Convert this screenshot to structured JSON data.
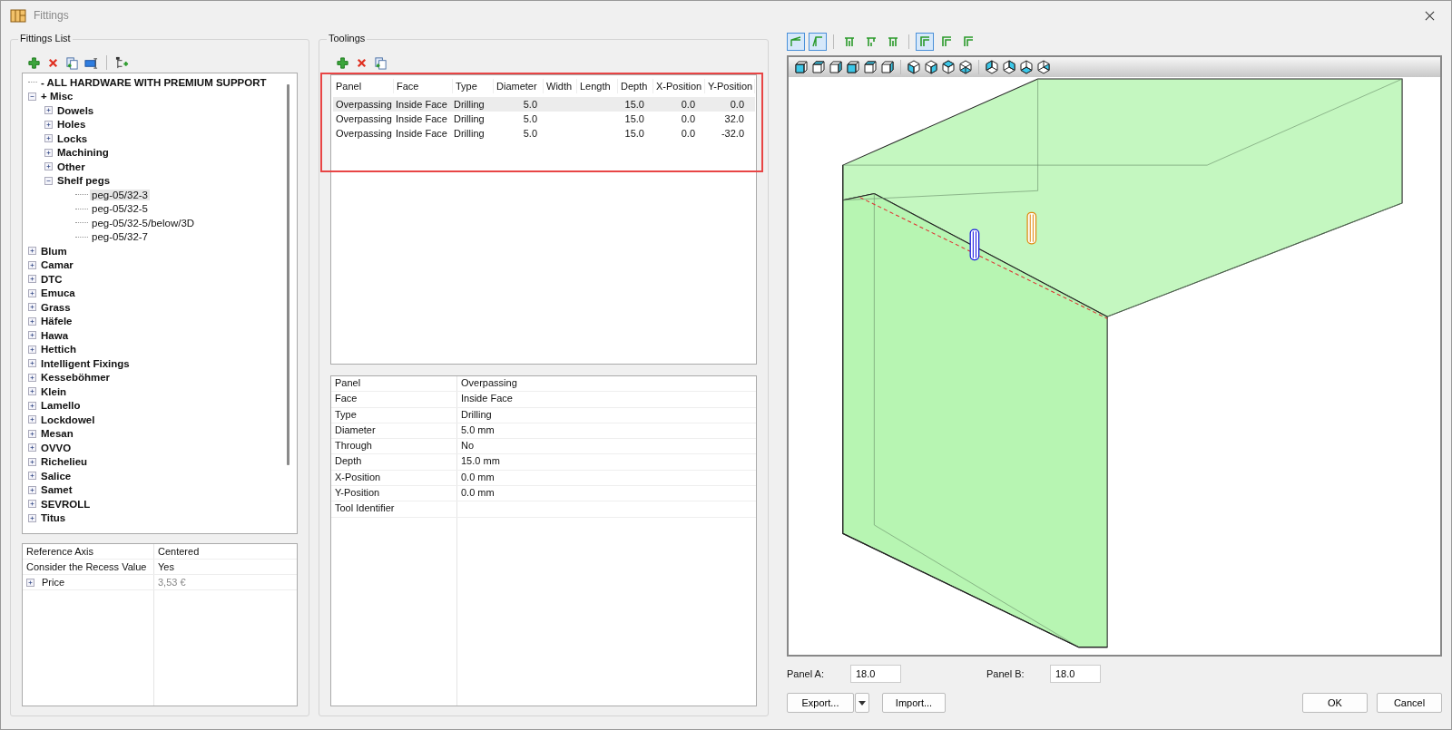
{
  "window": {
    "title": "Fittings"
  },
  "fittings_list": {
    "title": "Fittings List",
    "tree": [
      {
        "kind": "header",
        "label": "- ALL HARDWARE WITH PREMIUM SUPPORT",
        "selected": false
      },
      {
        "kind": "folder",
        "label": "+ Misc",
        "expanded": true,
        "selected": false,
        "children": [
          {
            "kind": "folder",
            "label": "Dowels",
            "expanded": false,
            "selected": false
          },
          {
            "kind": "folder",
            "label": "Holes",
            "expanded": false,
            "selected": false
          },
          {
            "kind": "folder",
            "label": "Locks",
            "expanded": false,
            "selected": false
          },
          {
            "kind": "folder",
            "label": "Machining",
            "expanded": false,
            "selected": false
          },
          {
            "kind": "folder",
            "label": "Other",
            "expanded": false,
            "selected": false
          },
          {
            "kind": "folder",
            "label": "Shelf pegs",
            "expanded": true,
            "selected": false,
            "children": [
              {
                "kind": "item",
                "label": "peg-05/32-3",
                "selected": true
              },
              {
                "kind": "item",
                "label": "peg-05/32-5",
                "selected": false
              },
              {
                "kind": "item",
                "label": "peg-05/32-5/below/3D",
                "selected": false
              },
              {
                "kind": "item",
                "label": "peg-05/32-7",
                "selected": false
              }
            ]
          }
        ]
      },
      {
        "kind": "folder",
        "label": "Blum",
        "expanded": false,
        "selected": false
      },
      {
        "kind": "folder",
        "label": "Camar",
        "expanded": false,
        "selected": false
      },
      {
        "kind": "folder",
        "label": "DTC",
        "expanded": false,
        "selected": false
      },
      {
        "kind": "folder",
        "label": "Emuca",
        "expanded": false,
        "selected": false
      },
      {
        "kind": "folder",
        "label": "Grass",
        "expanded": false,
        "selected": false
      },
      {
        "kind": "folder",
        "label": "Häfele",
        "expanded": false,
        "selected": false
      },
      {
        "kind": "folder",
        "label": "Hawa",
        "expanded": false,
        "selected": false
      },
      {
        "kind": "folder",
        "label": "Hettich",
        "expanded": false,
        "selected": false
      },
      {
        "kind": "folder",
        "label": "Intelligent Fixings",
        "expanded": false,
        "selected": false
      },
      {
        "kind": "folder",
        "label": "Kesseböhmer",
        "expanded": false,
        "selected": false
      },
      {
        "kind": "folder",
        "label": "Klein",
        "expanded": false,
        "selected": false
      },
      {
        "kind": "folder",
        "label": "Lamello",
        "expanded": false,
        "selected": false
      },
      {
        "kind": "folder",
        "label": "Lockdowel",
        "expanded": false,
        "selected": false
      },
      {
        "kind": "folder",
        "label": "Mesan",
        "expanded": false,
        "selected": false
      },
      {
        "kind": "folder",
        "label": "OVVO",
        "expanded": false,
        "selected": false
      },
      {
        "kind": "folder",
        "label": "Richelieu",
        "expanded": false,
        "selected": false
      },
      {
        "kind": "folder",
        "label": "Salice",
        "expanded": false,
        "selected": false
      },
      {
        "kind": "folder",
        "label": "Samet",
        "expanded": false,
        "selected": false
      },
      {
        "kind": "folder",
        "label": "SEVROLL",
        "expanded": false,
        "selected": false
      },
      {
        "kind": "folder",
        "label": "Titus",
        "expanded": false,
        "selected": false
      }
    ],
    "properties": [
      {
        "label": "Reference Axis",
        "value": "Centered",
        "disabled": false
      },
      {
        "label": "Consider the Recess Value",
        "value": "Yes",
        "disabled": false
      },
      {
        "label": "Price",
        "value": "3,53 €",
        "disabled": true,
        "expanded": false
      }
    ]
  },
  "toolings": {
    "title": "Toolings",
    "highlighted": true,
    "columns": [
      "Panel",
      "Face",
      "Type",
      "Diameter",
      "Width",
      "Length",
      "Depth",
      "X-Position",
      "Y-Position"
    ],
    "rows": [
      {
        "cells": [
          "Overpassing",
          "Inside Face",
          "Drilling",
          "5.0",
          "",
          "",
          "15.0",
          "0.0",
          "0.0"
        ],
        "selected": true
      },
      {
        "cells": [
          "Overpassing",
          "Inside Face",
          "Drilling",
          "5.0",
          "",
          "",
          "15.0",
          "0.0",
          "32.0"
        ],
        "selected": false
      },
      {
        "cells": [
          "Overpassing",
          "Inside Face",
          "Drilling",
          "5.0",
          "",
          "",
          "15.0",
          "0.0",
          "-32.0"
        ],
        "selected": false
      }
    ],
    "details": [
      {
        "label": "Panel",
        "value": "Overpassing"
      },
      {
        "label": "Face",
        "value": "Inside Face"
      },
      {
        "label": "Type",
        "value": "Drilling"
      },
      {
        "label": "Diameter",
        "value": "5.0 mm"
      },
      {
        "label": "Through",
        "value": "No"
      },
      {
        "label": "Depth",
        "value": "15.0 mm"
      },
      {
        "label": "X-Position",
        "value": "0.0 mm"
      },
      {
        "label": "Y-Position",
        "value": "0.0 mm"
      },
      {
        "label": "Tool Identifier"
      }
    ]
  },
  "viewer": {
    "joint_groups": [
      [
        {
          "selected": true
        },
        {
          "selected": true
        }
      ],
      [
        {
          "selected": false
        },
        {
          "selected": false
        },
        {
          "selected": false
        }
      ],
      [
        {
          "selected": true
        },
        {
          "selected": false
        },
        {
          "selected": false
        }
      ]
    ],
    "panel_a": {
      "label": "Panel A:",
      "value": "18.0"
    },
    "panel_b": {
      "label": "Panel B:",
      "value": "18.0"
    }
  },
  "buttons": {
    "export": "Export...",
    "import": "Import...",
    "ok": "OK",
    "cancel": "Cancel"
  }
}
